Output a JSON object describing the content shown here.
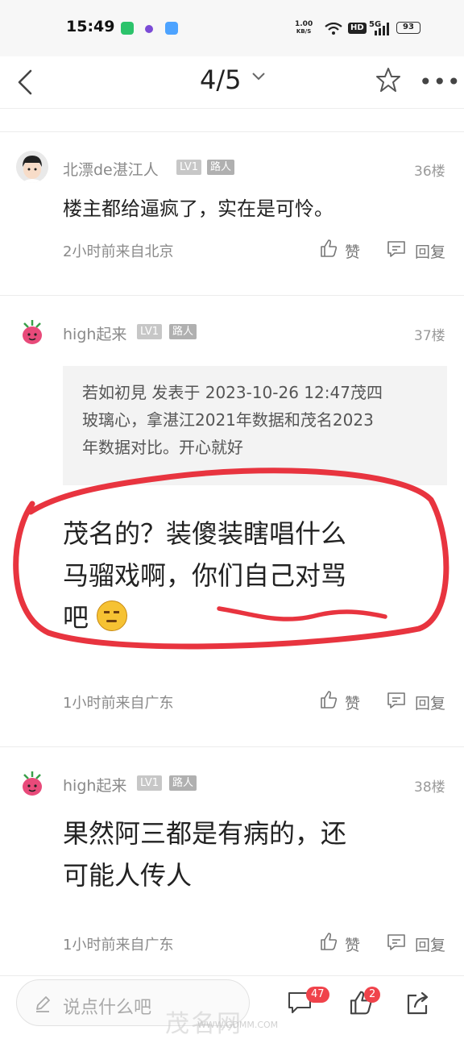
{
  "status_bar": {
    "time": "15:49",
    "net_speed": "1.00",
    "net_unit": "KB/S",
    "hd": "HD",
    "network": "5G",
    "battery": "93"
  },
  "nav": {
    "pager": "4/5"
  },
  "comments": [
    {
      "user": "北漂de湛江人",
      "level": "LV1",
      "role": "路人",
      "floor": "36楼",
      "text": "楼主都给逼疯了，实在是可怜。",
      "meta": "2小时前来自北京",
      "like": "赞",
      "reply": "回复"
    },
    {
      "user": "high起来",
      "level": "LV1",
      "role": "路人",
      "floor": "37楼",
      "quote_line1": "若如初見 发表于 2023-10-26 12:47茂四",
      "quote_line2": "玻璃心，拿湛江2021年数据和茂名2023",
      "quote_line3": "年数据对比。开心就好",
      "text_line1": "茂名的？装傻装瞎唱什么",
      "text_line2": "马骝戏啊，你们自己对骂",
      "text_line3": "吧",
      "meta": "1小时前来自广东",
      "like": "赞",
      "reply": "回复"
    },
    {
      "user": "high起来",
      "level": "LV1",
      "role": "路人",
      "floor": "38楼",
      "text_line1": "果然阿三都是有病的，还",
      "text_line2": "可能人传人",
      "meta": "1小时前来自广东",
      "like": "赞",
      "reply": "回复"
    }
  ],
  "bottom_bar": {
    "placeholder": "说点什么吧",
    "comment_count": "47",
    "like_count": "2"
  },
  "watermark": {
    "brand": "茂名网",
    "url": "WWW.GDMM.COM"
  },
  "colors": {
    "annotation_red": "#e8343f",
    "badge_red": "#f0434b"
  }
}
